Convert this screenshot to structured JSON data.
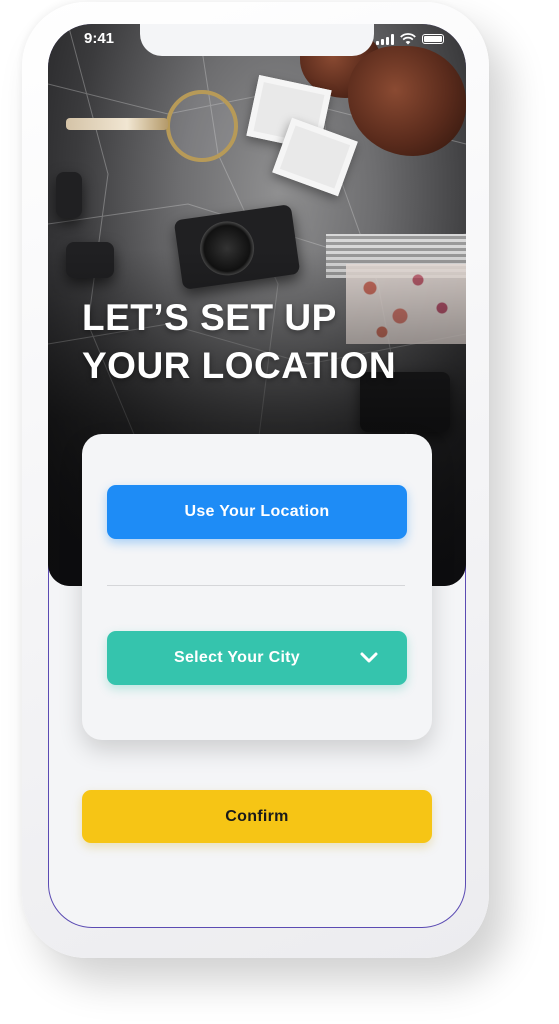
{
  "status_bar": {
    "time": "9:41",
    "icons": [
      "signal-icon",
      "wifi-icon",
      "battery-icon"
    ]
  },
  "hero": {
    "headline_line1": "LET’S SET UP",
    "headline_line2": "YOUR LOCATION"
  },
  "card": {
    "use_location_label": "Use Your Location",
    "select_city_label": "Select Your City",
    "select_city_icon": "chevron-down-icon"
  },
  "confirm_label": "Confirm",
  "colors": {
    "primary_blue": "#1e8cf6",
    "teal": "#35c4ad",
    "yellow": "#f6c515",
    "background": "#f4f5f7"
  }
}
